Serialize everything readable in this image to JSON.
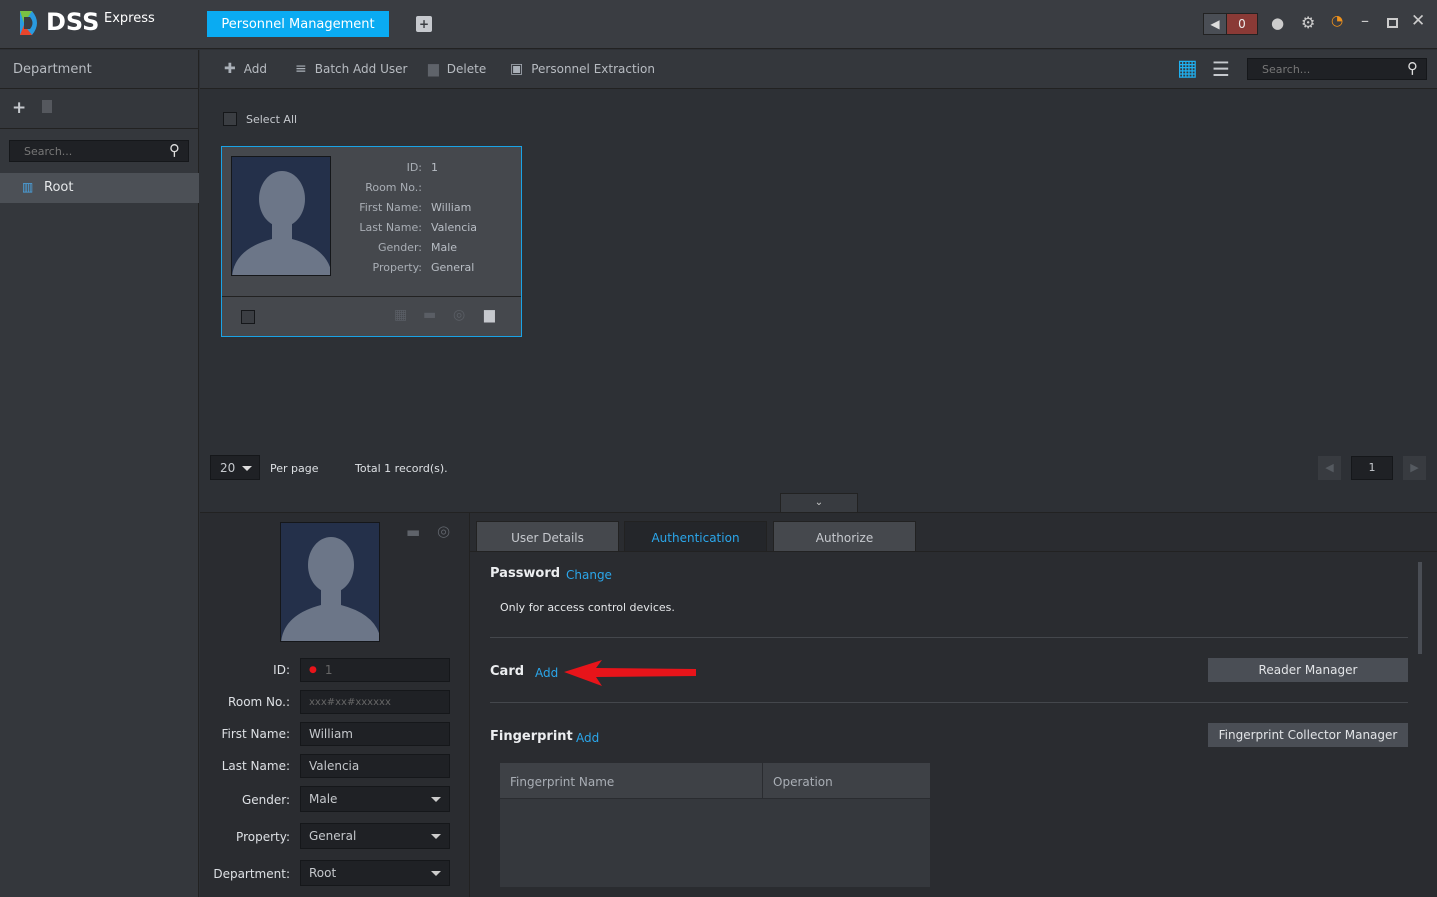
{
  "app": {
    "logo": "DSS",
    "logo_sub": "Express",
    "tab": "Personnel Management",
    "alarm_count": "0"
  },
  "sidebar": {
    "title": "Department",
    "search_placeholder": "Search...",
    "tree": [
      {
        "label": "Root"
      }
    ]
  },
  "toolbar": {
    "add": "Add",
    "batch_add": "Batch Add User",
    "delete": "Delete",
    "extraction": "Personnel Extraction",
    "search_placeholder": "Search..."
  },
  "list": {
    "select_all": "Select All",
    "per_page_value": "20",
    "per_page_label": "Per page",
    "total": "Total 1 record(s).",
    "page": "1"
  },
  "card": {
    "labels": [
      "ID:",
      "Room No.:",
      "First Name:",
      "Last Name:",
      "Gender:",
      "Property:"
    ],
    "values": [
      "1",
      "",
      "William",
      "Valencia",
      "Male",
      "General"
    ]
  },
  "detail": {
    "fields": [
      {
        "label": "ID:",
        "value": "1"
      },
      {
        "label": "Room No.:",
        "placeholder": "xxx#xx#xxxxxx"
      },
      {
        "label": "First Name:",
        "value": "William"
      },
      {
        "label": "Last Name:",
        "value": "Valencia"
      },
      {
        "label": "Gender:",
        "value": "Male"
      },
      {
        "label": "Property:",
        "value": "General"
      },
      {
        "label": "Department:",
        "value": "Root"
      }
    ],
    "tabs": [
      "User Details",
      "Authentication",
      "Authorize"
    ],
    "active_tab": "Authentication",
    "password": {
      "title": "Password",
      "link": "Change",
      "note": "Only for access control devices."
    },
    "card": {
      "title": "Card",
      "link": "Add",
      "button": "Reader Manager"
    },
    "fingerprint": {
      "title": "Fingerprint",
      "link": "Add",
      "button": "Fingerprint Collector Manager",
      "columns": [
        "Fingerprint Name",
        "Operation"
      ]
    }
  },
  "colors": {
    "accent": "#1aa3e6",
    "annotation": "#e8141a"
  }
}
